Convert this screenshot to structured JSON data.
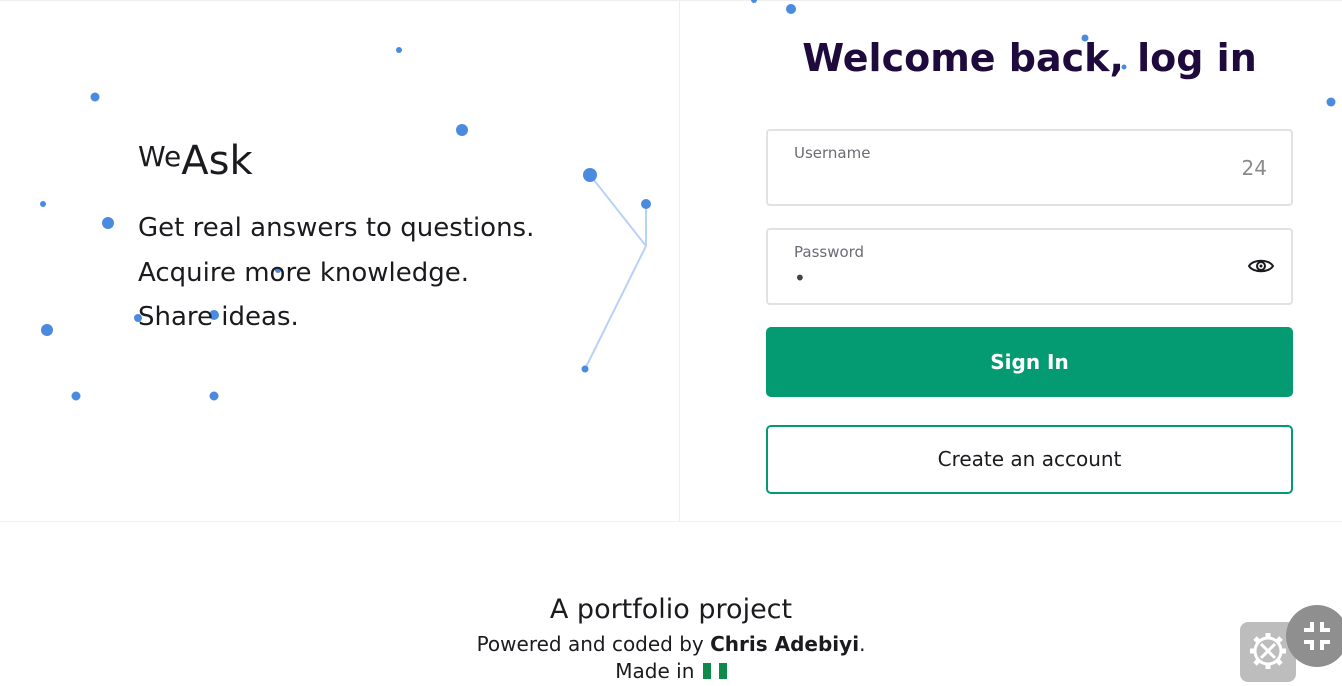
{
  "brand": {
    "prefix": "We",
    "name": "Ask"
  },
  "tagline": [
    "Get real answers to questions.",
    "Acquire more knowledge.",
    "Share ideas."
  ],
  "login": {
    "title": "Welcome back, log in",
    "username": {
      "label": "Username",
      "counter": "24",
      "value": ""
    },
    "password": {
      "label": "Password",
      "value": "•"
    },
    "password_toggle_icon": "eye-icon",
    "signin_label": "Sign In",
    "create_label": "Create an account"
  },
  "footer": {
    "line1": "A portfolio project",
    "line2_prefix": "Powered and coded by ",
    "author": "Chris Adebiyi",
    "line2_suffix": ".",
    "line3": "Made in"
  },
  "widgets": {
    "settings_icon": "gear-wrench-icon",
    "collapse_icon": "compress-icon"
  },
  "colors": {
    "primary": "#049b72",
    "title": "#1e0a3c",
    "particle": "#4a8be0",
    "particle_line": "#b7d2f7"
  }
}
